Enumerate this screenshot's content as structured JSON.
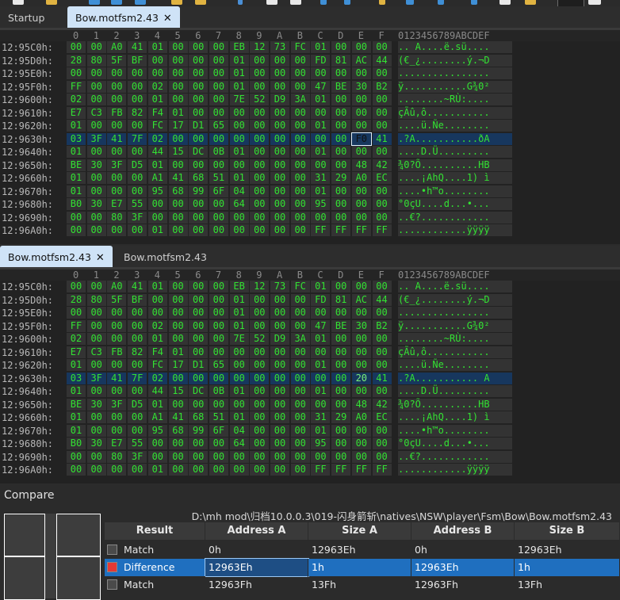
{
  "top_tabs": {
    "tabs": [
      {
        "label": "Startup"
      },
      {
        "label": "Bow.motfsm2.43"
      }
    ]
  },
  "bottom_tabs": {
    "tabs": [
      {
        "label": "Bow.motfsm2.43"
      },
      {
        "label": "Bow.motfsm2.43"
      }
    ]
  },
  "hex_header": {
    "columns": [
      "0",
      "1",
      "2",
      "3",
      "4",
      "5",
      "6",
      "7",
      "8",
      "9",
      "A",
      "B",
      "C",
      "D",
      "E",
      "F"
    ],
    "ascii_header": "0123456789ABCDEF"
  },
  "hex_top": {
    "rows": [
      {
        "address": "12:95C0h:",
        "bytes": [
          "00",
          "00",
          "A0",
          "41",
          "01",
          "00",
          "00",
          "00",
          "EB",
          "12",
          "73",
          "FC",
          "01",
          "00",
          "00",
          "00"
        ],
        "ascii": ".. A....ë.sü...."
      },
      {
        "address": "12:95D0h:",
        "bytes": [
          "28",
          "80",
          "5F",
          "BF",
          "00",
          "00",
          "00",
          "00",
          "01",
          "00",
          "00",
          "00",
          "FD",
          "81",
          "AC",
          "44"
        ],
        "ascii": "(€_¿........ý.¬D"
      },
      {
        "address": "12:95E0h:",
        "bytes": [
          "00",
          "00",
          "00",
          "00",
          "00",
          "00",
          "00",
          "00",
          "01",
          "00",
          "00",
          "00",
          "00",
          "00",
          "00",
          "00"
        ],
        "ascii": "................"
      },
      {
        "address": "12:95F0h:",
        "bytes": [
          "FF",
          "00",
          "00",
          "00",
          "02",
          "00",
          "00",
          "00",
          "01",
          "00",
          "00",
          "00",
          "47",
          "BE",
          "30",
          "B2"
        ],
        "ascii": "ÿ...........G¾0²"
      },
      {
        "address": "12:9600h:",
        "bytes": [
          "02",
          "00",
          "00",
          "00",
          "01",
          "00",
          "00",
          "00",
          "7E",
          "52",
          "D9",
          "3A",
          "01",
          "00",
          "00",
          "00"
        ],
        "ascii": "........~RÙ:...."
      },
      {
        "address": "12:9610h:",
        "bytes": [
          "E7",
          "C3",
          "FB",
          "82",
          "F4",
          "01",
          "00",
          "00",
          "00",
          "00",
          "00",
          "00",
          "00",
          "00",
          "00",
          "00"
        ],
        "ascii": "çÃû‚ô..........."
      },
      {
        "address": "12:9620h:",
        "bytes": [
          "01",
          "00",
          "00",
          "00",
          "FC",
          "17",
          "D1",
          "65",
          "00",
          "00",
          "00",
          "00",
          "01",
          "00",
          "00",
          "00"
        ],
        "ascii": "....ü.Ñe........"
      },
      {
        "address": "12:9630h:",
        "bytes": [
          "03",
          "3F",
          "41",
          "7F",
          "02",
          "00",
          "00",
          "00",
          "00",
          "00",
          "00",
          "00",
          "00",
          "00",
          "F0",
          "41"
        ],
        "ascii": ".?A...........ðA"
      },
      {
        "address": "12:9640h:",
        "bytes": [
          "01",
          "00",
          "00",
          "00",
          "44",
          "15",
          "DC",
          "0B",
          "01",
          "00",
          "00",
          "00",
          "01",
          "00",
          "00",
          "00"
        ],
        "ascii": "....D.Ü........."
      },
      {
        "address": "12:9650h:",
        "bytes": [
          "BE",
          "30",
          "3F",
          "D5",
          "01",
          "00",
          "00",
          "00",
          "00",
          "00",
          "00",
          "00",
          "00",
          "00",
          "48",
          "42"
        ],
        "ascii": "¾0?Õ..........HB"
      },
      {
        "address": "12:9660h:",
        "bytes": [
          "01",
          "00",
          "00",
          "00",
          "A1",
          "41",
          "68",
          "51",
          "01",
          "00",
          "00",
          "00",
          "31",
          "29",
          "A0",
          "EC"
        ],
        "ascii": "....¡AhQ....1) ì"
      },
      {
        "address": "12:9670h:",
        "bytes": [
          "01",
          "00",
          "00",
          "00",
          "95",
          "68",
          "99",
          "6F",
          "04",
          "00",
          "00",
          "00",
          "01",
          "00",
          "00",
          "00"
        ],
        "ascii": "....•h™o........"
      },
      {
        "address": "12:9680h:",
        "bytes": [
          "B0",
          "30",
          "E7",
          "55",
          "00",
          "00",
          "00",
          "00",
          "64",
          "00",
          "00",
          "00",
          "95",
          "00",
          "00",
          "00"
        ],
        "ascii": "°0çU....d...•..."
      },
      {
        "address": "12:9690h:",
        "bytes": [
          "00",
          "00",
          "80",
          "3F",
          "00",
          "00",
          "00",
          "00",
          "00",
          "00",
          "00",
          "00",
          "00",
          "00",
          "00",
          "00"
        ],
        "ascii": "..€?............"
      },
      {
        "address": "12:96A0h:",
        "bytes": [
          "00",
          "00",
          "00",
          "00",
          "01",
          "00",
          "00",
          "00",
          "00",
          "00",
          "00",
          "00",
          "FF",
          "FF",
          "FF",
          "FF"
        ],
        "ascii": "............ÿÿÿÿ"
      }
    ]
  },
  "hex_bottom": {
    "rows": [
      {
        "address": "12:95C0h:",
        "bytes": [
          "00",
          "00",
          "A0",
          "41",
          "01",
          "00",
          "00",
          "00",
          "EB",
          "12",
          "73",
          "FC",
          "01",
          "00",
          "00",
          "00"
        ],
        "ascii": ".. A....ë.sü...."
      },
      {
        "address": "12:95D0h:",
        "bytes": [
          "28",
          "80",
          "5F",
          "BF",
          "00",
          "00",
          "00",
          "00",
          "01",
          "00",
          "00",
          "00",
          "FD",
          "81",
          "AC",
          "44"
        ],
        "ascii": "(€_¿........ý.¬D"
      },
      {
        "address": "12:95E0h:",
        "bytes": [
          "00",
          "00",
          "00",
          "00",
          "00",
          "00",
          "00",
          "00",
          "01",
          "00",
          "00",
          "00",
          "00",
          "00",
          "00",
          "00"
        ],
        "ascii": "................"
      },
      {
        "address": "12:95F0h:",
        "bytes": [
          "FF",
          "00",
          "00",
          "00",
          "02",
          "00",
          "00",
          "00",
          "01",
          "00",
          "00",
          "00",
          "47",
          "BE",
          "30",
          "B2"
        ],
        "ascii": "ÿ...........G¾0²"
      },
      {
        "address": "12:9600h:",
        "bytes": [
          "02",
          "00",
          "00",
          "00",
          "01",
          "00",
          "00",
          "00",
          "7E",
          "52",
          "D9",
          "3A",
          "01",
          "00",
          "00",
          "00"
        ],
        "ascii": "........~RÙ:...."
      },
      {
        "address": "12:9610h:",
        "bytes": [
          "E7",
          "C3",
          "FB",
          "82",
          "F4",
          "01",
          "00",
          "00",
          "00",
          "00",
          "00",
          "00",
          "00",
          "00",
          "00",
          "00"
        ],
        "ascii": "çÃû‚ô..........."
      },
      {
        "address": "12:9620h:",
        "bytes": [
          "01",
          "00",
          "00",
          "00",
          "FC",
          "17",
          "D1",
          "65",
          "00",
          "00",
          "00",
          "00",
          "01",
          "00",
          "00",
          "00"
        ],
        "ascii": "....ü.Ñe........"
      },
      {
        "address": "12:9630h:",
        "bytes": [
          "03",
          "3F",
          "41",
          "7F",
          "02",
          "00",
          "00",
          "00",
          "00",
          "00",
          "00",
          "00",
          "00",
          "00",
          "20",
          "41"
        ],
        "ascii": ".?A........... A"
      },
      {
        "address": "12:9640h:",
        "bytes": [
          "01",
          "00",
          "00",
          "00",
          "44",
          "15",
          "DC",
          "0B",
          "01",
          "00",
          "00",
          "00",
          "01",
          "00",
          "00",
          "00"
        ],
        "ascii": "....D.Ü........."
      },
      {
        "address": "12:9650h:",
        "bytes": [
          "BE",
          "30",
          "3F",
          "D5",
          "01",
          "00",
          "00",
          "00",
          "00",
          "00",
          "00",
          "00",
          "00",
          "00",
          "48",
          "42"
        ],
        "ascii": "¾0?Õ..........HB"
      },
      {
        "address": "12:9660h:",
        "bytes": [
          "01",
          "00",
          "00",
          "00",
          "A1",
          "41",
          "68",
          "51",
          "01",
          "00",
          "00",
          "00",
          "31",
          "29",
          "A0",
          "EC"
        ],
        "ascii": "....¡AhQ....1) ì"
      },
      {
        "address": "12:9670h:",
        "bytes": [
          "01",
          "00",
          "00",
          "00",
          "95",
          "68",
          "99",
          "6F",
          "04",
          "00",
          "00",
          "00",
          "01",
          "00",
          "00",
          "00"
        ],
        "ascii": "....•h™o........"
      },
      {
        "address": "12:9680h:",
        "bytes": [
          "B0",
          "30",
          "E7",
          "55",
          "00",
          "00",
          "00",
          "00",
          "64",
          "00",
          "00",
          "00",
          "95",
          "00",
          "00",
          "00"
        ],
        "ascii": "°0çU....d...•..."
      },
      {
        "address": "12:9690h:",
        "bytes": [
          "00",
          "00",
          "80",
          "3F",
          "00",
          "00",
          "00",
          "00",
          "00",
          "00",
          "00",
          "00",
          "00",
          "00",
          "00",
          "00"
        ],
        "ascii": "..€?............"
      },
      {
        "address": "12:96A0h:",
        "bytes": [
          "00",
          "00",
          "00",
          "00",
          "01",
          "00",
          "00",
          "00",
          "00",
          "00",
          "00",
          "00",
          "FF",
          "FF",
          "FF",
          "FF"
        ],
        "ascii": "............ÿÿÿÿ"
      }
    ]
  },
  "compare": {
    "title": "Compare",
    "path": "D:\\mh mod\\归档10.0.0.3\\019-闪身箭斩\\natives\\NSW\\player\\Fsm\\Bow\\Bow.motfsm2.43",
    "headers": [
      "Result",
      "Address A",
      "Size A",
      "Address B",
      "Size B"
    ],
    "rows": [
      {
        "result": "Match",
        "address_a": "0h",
        "size_a": "12963Eh",
        "address_b": "0h",
        "size_b": "12963Eh",
        "color": "#4a4a4a"
      },
      {
        "result": "Difference",
        "address_a": "12963Eh",
        "size_a": "1h",
        "address_b": "12963Eh",
        "size_b": "1h",
        "color": "#e53935"
      },
      {
        "result": "Match",
        "address_a": "12963Fh",
        "size_a": "13Fh",
        "address_b": "12963Fh",
        "size_b": "13Fh",
        "color": "#4a4a4a"
      }
    ]
  }
}
